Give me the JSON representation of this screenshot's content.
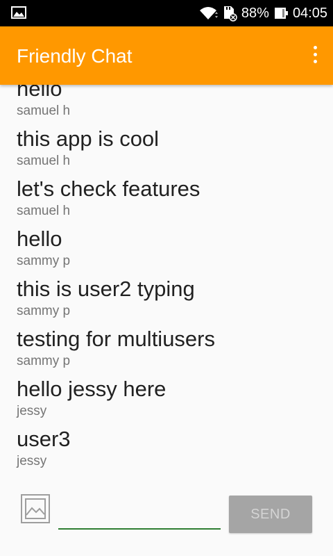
{
  "status_bar": {
    "icons": [
      "gallery-icon",
      "wifi-icon",
      "sd-card-icon",
      "battery-icon"
    ],
    "battery": "88%",
    "time": "04:05"
  },
  "app_bar": {
    "title": "Friendly Chat",
    "background_color": "#ff9800",
    "menu_icon": "overflow-menu-icon"
  },
  "messages": [
    {
      "text": "hello",
      "author": "samuel h"
    },
    {
      "text": "this app is cool",
      "author": "samuel h"
    },
    {
      "text": "let's check features",
      "author": "samuel h"
    },
    {
      "text": "hello",
      "author": "sammy p"
    },
    {
      "text": "this is user2 typing",
      "author": "sammy p"
    },
    {
      "text": "testing for multiusers",
      "author": "sammy p"
    },
    {
      "text": "hello jessy here",
      "author": "jessy"
    },
    {
      "text": "user3",
      "author": "jessy"
    }
  ],
  "composer": {
    "image_icon": "image-icon",
    "input_value": "",
    "input_placeholder": "",
    "send_label": "SEND",
    "send_enabled": false,
    "underline_color": "#2e7d32"
  }
}
